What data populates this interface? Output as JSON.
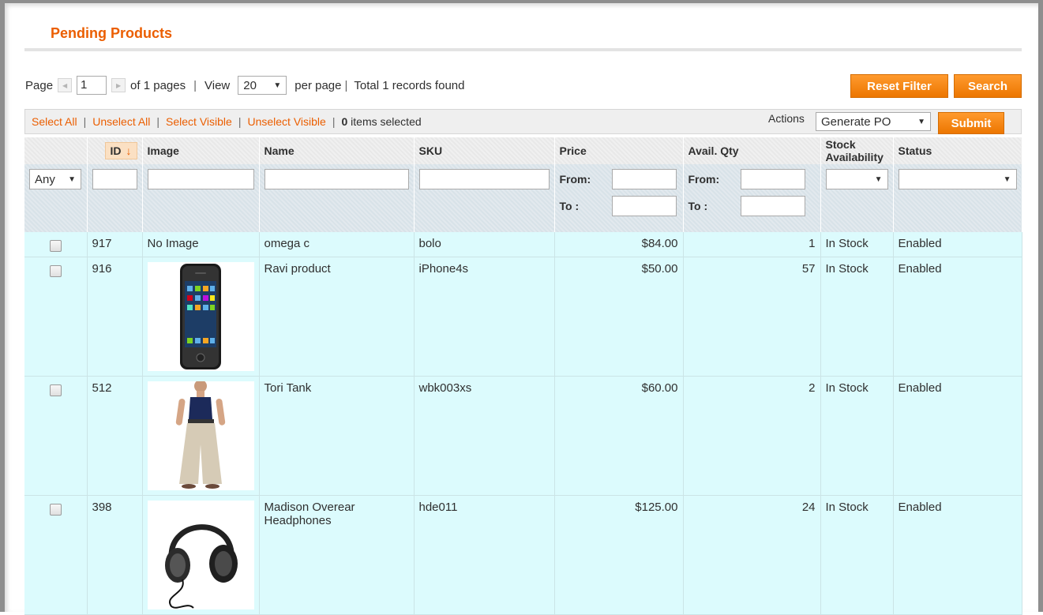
{
  "page": {
    "title": "Pending Products"
  },
  "pager": {
    "page_label": "Page",
    "page_value": "1",
    "of_pages": "of 1 pages",
    "sep": "|",
    "view_label": "View",
    "view_value": "20",
    "per_page": "per page",
    "total": "Total 1 records found"
  },
  "buttons": {
    "reset_filter": "Reset Filter",
    "search": "Search",
    "submit": "Submit"
  },
  "massaction": {
    "select_all": "Select All",
    "unselect_all": "Unselect All",
    "select_visible": "Select Visible",
    "unselect_visible": "Unselect Visible",
    "selected_count": "0",
    "selected_suffix": "items selected",
    "actions_label": "Actions",
    "action_value": "Generate PO"
  },
  "columns": {
    "id": "ID",
    "image": "Image",
    "name": "Name",
    "sku": "SKU",
    "price": "Price",
    "qty": "Avail. Qty",
    "stock": "Stock Availability",
    "status": "Status"
  },
  "filters": {
    "any": "Any",
    "from": "From:",
    "to": "To :"
  },
  "icons": {
    "sort": "sort-desc-arrow-icon",
    "dropdown": "triangle-down-icon",
    "prev": "prev-page-icon",
    "next": "next-page-icon"
  },
  "colors": {
    "accent": "#eb5e00",
    "row_bg": "#dcfbfd",
    "button": "#f18200"
  },
  "rows": [
    {
      "id": "917",
      "image": "No Image",
      "name": "omega c",
      "sku": "bolo",
      "price": "$84.00",
      "qty": "1",
      "stock": "In Stock",
      "status": "Enabled"
    },
    {
      "id": "916",
      "image": "",
      "name": "Ravi product",
      "sku": "iPhone4s",
      "price": "$50.00",
      "qty": "57",
      "stock": "In Stock",
      "status": "Enabled"
    },
    {
      "id": "512",
      "image": "",
      "name": "Tori Tank",
      "sku": "wbk003xs",
      "price": "$60.00",
      "qty": "2",
      "stock": "In Stock",
      "status": "Enabled"
    },
    {
      "id": "398",
      "image": "",
      "name": "Madison Overear Headphones",
      "sku": "hde011",
      "price": "$125.00",
      "qty": "24",
      "stock": "In Stock",
      "status": "Enabled"
    }
  ]
}
